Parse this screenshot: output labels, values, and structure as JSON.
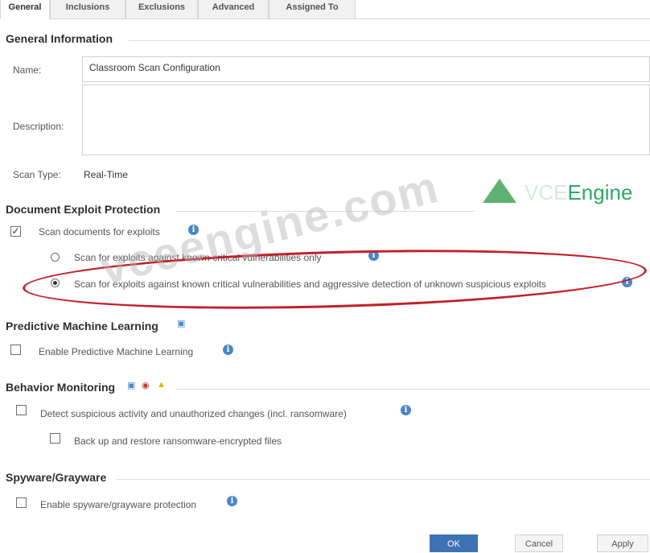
{
  "tabs": [
    {
      "label": "General"
    },
    {
      "label": "Inclusions"
    },
    {
      "label": "Exclusions"
    },
    {
      "label": "Advanced"
    },
    {
      "label": "Assigned To"
    }
  ],
  "general_info": {
    "title": "General Information",
    "name_label": "Name:",
    "name_value": "Classroom Scan Configuration",
    "description_label": "Description:",
    "description_value": "",
    "scan_type_label": "Scan Type:",
    "scan_type_value": "Real-Time"
  },
  "doc_exploit": {
    "title": "Document Exploit Protection",
    "scan_docs_label": "Scan documents for exploits",
    "scan_docs_checked": true,
    "radio_option_1": "Scan for exploits against known critical vulnerabilities only",
    "radio_option_2": "Scan for exploits against known critical vulnerabilities and aggressive detection of unknown suspicious exploits",
    "selected_option": 2
  },
  "predictive_ml": {
    "title": "Predictive Machine Learning",
    "enable_label": "Enable Predictive Machine Learning",
    "checked": false
  },
  "behavior": {
    "title": "Behavior Monitoring",
    "detect_label": "Detect suspicious activity and unauthorized changes (incl. ransomware)",
    "backup_label": "Back up and restore ransomware-encrypted files"
  },
  "spyware": {
    "title": "Spyware/Grayware",
    "enable_label": "Enable spyware/grayware protection"
  },
  "icons": {
    "info": "info-icon",
    "checkmark": "✓",
    "windows": "windows-icon",
    "shield": "shield-icon",
    "warning": "warning-icon"
  },
  "watermark": {
    "brand_prefix": "VCE",
    "brand_suffix": "Engine",
    "big": "vceengine.com"
  },
  "buttons": {
    "ok": "OK",
    "cancel": "Cancel",
    "apply": "Apply"
  },
  "colors": {
    "primary_button": "#3d73b4",
    "info": "#4a86c8",
    "annotation": "#c3202a",
    "brand_green": "#2fa866"
  }
}
